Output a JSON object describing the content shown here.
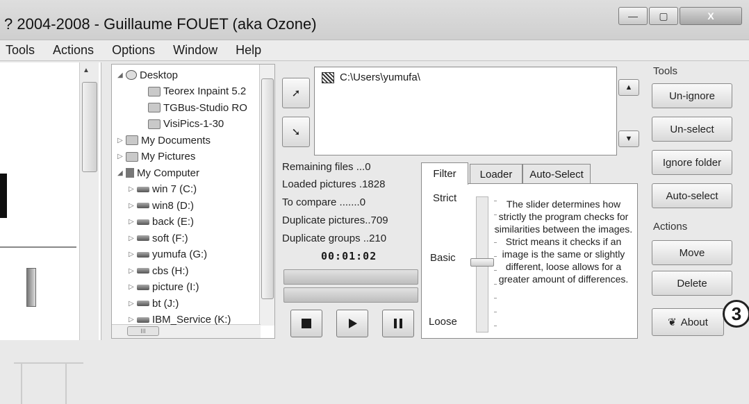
{
  "window": {
    "title": "? 2004-2008 - Guillaume FOUET (aka Ozone)",
    "controls": {
      "minimize": "—",
      "maximize": "▢",
      "close": "X"
    }
  },
  "menu": [
    {
      "label": "Tools"
    },
    {
      "label": "Actions"
    },
    {
      "label": "Options"
    },
    {
      "label": "Window"
    },
    {
      "label": "Help"
    }
  ],
  "tree": {
    "items": [
      {
        "label": "Desktop",
        "icon": "desktop-icon",
        "expander": "◢"
      },
      {
        "label": "Teorex Inpaint 5.2",
        "icon": "folder-icon",
        "expander": ""
      },
      {
        "label": "TGBus-Studio RO",
        "icon": "folder-icon",
        "expander": ""
      },
      {
        "label": "VisiPics-1-30",
        "icon": "folder-icon",
        "expander": ""
      },
      {
        "label": "My Documents",
        "icon": "folder-icon",
        "expander": "▷"
      },
      {
        "label": "My Pictures",
        "icon": "folder-icon",
        "expander": "▷"
      },
      {
        "label": "My Computer",
        "icon": "computer-icon",
        "expander": "◢"
      },
      {
        "label": "win 7 (C:)",
        "icon": "drive-icon",
        "expander": "▷"
      },
      {
        "label": "win8 (D:)",
        "icon": "drive-icon",
        "expander": "▷"
      },
      {
        "label": "back (E:)",
        "icon": "drive-icon",
        "expander": "▷"
      },
      {
        "label": "soft (F:)",
        "icon": "drive-icon",
        "expander": "▷"
      },
      {
        "label": "yumufa (G:)",
        "icon": "drive-icon",
        "expander": "▷"
      },
      {
        "label": "cbs (H:)",
        "icon": "drive-icon",
        "expander": "▷"
      },
      {
        "label": "picture (I:)",
        "icon": "drive-icon",
        "expander": "▷"
      },
      {
        "label": "bt (J:)",
        "icon": "drive-icon",
        "expander": "▷"
      },
      {
        "label": "IBM_Service (K:)",
        "icon": "drive-icon",
        "expander": "▷"
      }
    ],
    "hscroll_label": "III"
  },
  "paths": {
    "entries": [
      {
        "label": "C:\\Users\\yumufa\\"
      }
    ]
  },
  "stats": {
    "remaining": "Remaining files ...0",
    "loaded": "Loaded pictures .1828",
    "to_compare": "To compare .......0",
    "duplicate_pictures": "Duplicate pictures..709",
    "duplicate_groups": "Duplicate groups ..210",
    "timer": "00:01:02"
  },
  "tabs": [
    {
      "label": "Filter"
    },
    {
      "label": "Loader"
    },
    {
      "label": "Auto-Select"
    }
  ],
  "filter": {
    "strict": "Strict",
    "basic": "Basic",
    "loose": "Loose",
    "slider_position": 0.47,
    "description": "The slider determines how strictly the program checks for similarities between the images. Strict means it checks if an image is the same or slightly different, loose allows for a greater amount of differences."
  },
  "tools": {
    "label": "Tools",
    "unignore": "Un-ignore",
    "unselect": "Un-select",
    "ignore_folder": "Ignore folder",
    "auto_select": "Auto-select"
  },
  "actions": {
    "label": "Actions",
    "move": "Move",
    "delete": "Delete",
    "about": "About"
  },
  "annotation": {
    "step_number": "3"
  }
}
